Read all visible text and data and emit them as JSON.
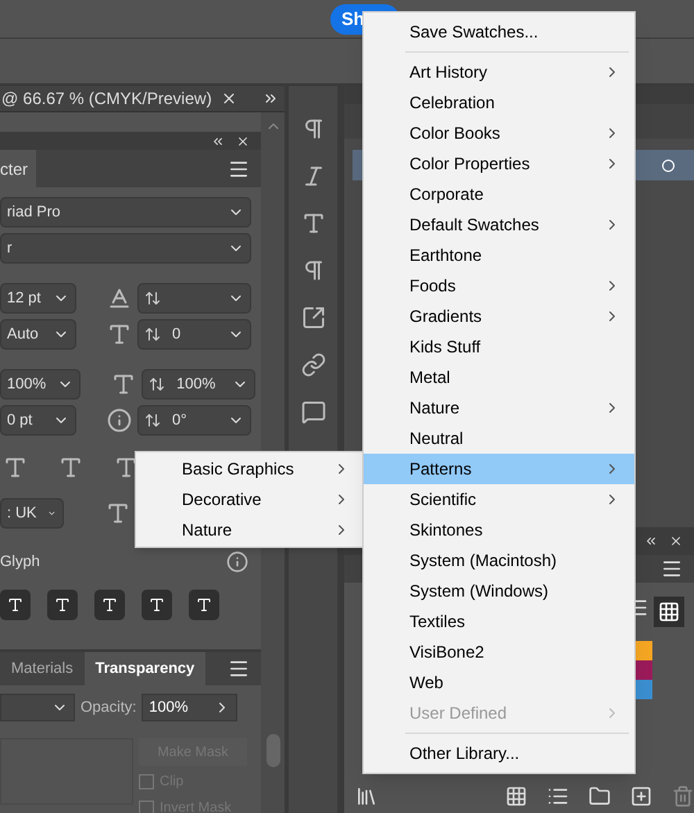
{
  "top_bar": {
    "share_button": "Sh"
  },
  "document_tab": {
    "title": "@ 66.67 % (CMYK/Preview)"
  },
  "character_panel": {
    "tab": "cter",
    "font_family": "riad Pro",
    "font_style": "r",
    "fields": [
      {
        "value": "12 pt"
      },
      {
        "value": "Auto"
      },
      {
        "value": "0"
      },
      {
        "value": "100%"
      },
      {
        "value": "100%"
      },
      {
        "value": "0 pt"
      },
      {
        "value": "0°"
      }
    ],
    "language": ": UK",
    "glyph_label": "Glyph"
  },
  "transparency_panel": {
    "tabs": [
      {
        "label": "Materials",
        "selected": false
      },
      {
        "label": "Transparency",
        "selected": true
      }
    ],
    "opacity_label": "Opacity:",
    "opacity_value": "100%",
    "make_mask": {
      "label": "Make Mask",
      "disabled": true
    },
    "checkboxes": [
      {
        "label": "Clip",
        "checked": false
      },
      {
        "label": "Invert Mask",
        "checked": false
      }
    ]
  },
  "swatches": [
    {
      "color": "#f5a623"
    },
    {
      "color": "#9b1b5a"
    },
    {
      "color": "#3b8fd0"
    }
  ],
  "submenu": [
    {
      "label": "Basic Graphics",
      "submenu": true
    },
    {
      "label": "Decorative",
      "submenu": true
    },
    {
      "label": "Nature",
      "submenu": true
    }
  ],
  "menu": [
    {
      "kind": "item",
      "label": "Save Swatches...",
      "submenu": false,
      "selected": false,
      "disabled": false
    },
    {
      "kind": "separator"
    },
    {
      "kind": "item",
      "label": "Art History",
      "submenu": true,
      "selected": false,
      "disabled": false
    },
    {
      "kind": "item",
      "label": "Celebration",
      "submenu": false,
      "selected": false,
      "disabled": false
    },
    {
      "kind": "item",
      "label": "Color Books",
      "submenu": true,
      "selected": false,
      "disabled": false
    },
    {
      "kind": "item",
      "label": "Color Properties",
      "submenu": true,
      "selected": false,
      "disabled": false
    },
    {
      "kind": "item",
      "label": "Corporate",
      "submenu": false,
      "selected": false,
      "disabled": false
    },
    {
      "kind": "item",
      "label": "Default Swatches",
      "submenu": true,
      "selected": false,
      "disabled": false
    },
    {
      "kind": "item",
      "label": "Earthtone",
      "submenu": false,
      "selected": false,
      "disabled": false
    },
    {
      "kind": "item",
      "label": "Foods",
      "submenu": true,
      "selected": false,
      "disabled": false
    },
    {
      "kind": "item",
      "label": "Gradients",
      "submenu": true,
      "selected": false,
      "disabled": false
    },
    {
      "kind": "item",
      "label": "Kids Stuff",
      "submenu": false,
      "selected": false,
      "disabled": false
    },
    {
      "kind": "item",
      "label": "Metal",
      "submenu": false,
      "selected": false,
      "disabled": false
    },
    {
      "kind": "item",
      "label": "Nature",
      "submenu": true,
      "selected": false,
      "disabled": false
    },
    {
      "kind": "item",
      "label": "Neutral",
      "submenu": false,
      "selected": false,
      "disabled": false
    },
    {
      "kind": "item",
      "label": "Patterns",
      "submenu": true,
      "selected": true,
      "disabled": false
    },
    {
      "kind": "item",
      "label": "Scientific",
      "submenu": true,
      "selected": false,
      "disabled": false
    },
    {
      "kind": "item",
      "label": "Skintones",
      "submenu": false,
      "selected": false,
      "disabled": false
    },
    {
      "kind": "item",
      "label": "System (Macintosh)",
      "submenu": false,
      "selected": false,
      "disabled": false
    },
    {
      "kind": "item",
      "label": "System (Windows)",
      "submenu": false,
      "selected": false,
      "disabled": false
    },
    {
      "kind": "item",
      "label": "Textiles",
      "submenu": false,
      "selected": false,
      "disabled": false
    },
    {
      "kind": "item",
      "label": "VisiBone2",
      "submenu": false,
      "selected": false,
      "disabled": false
    },
    {
      "kind": "item",
      "label": "Web",
      "submenu": false,
      "selected": false,
      "disabled": false
    },
    {
      "kind": "item",
      "label": "User Defined",
      "submenu": true,
      "selected": false,
      "disabled": true
    },
    {
      "kind": "separator"
    },
    {
      "kind": "item",
      "label": "Other Library...",
      "submenu": false,
      "selected": false,
      "disabled": false
    }
  ]
}
